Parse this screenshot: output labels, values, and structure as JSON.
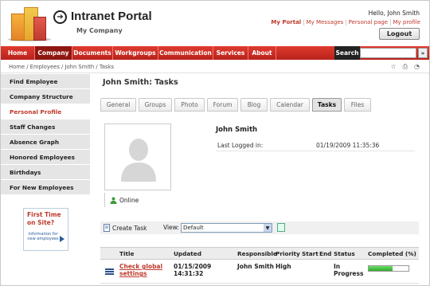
{
  "header": {
    "portal_title": "Intranet Portal",
    "company": "My Company",
    "greeting": "Hello, John Smith",
    "links": [
      "My Portal",
      "My Messages",
      "Personal page",
      "My profile"
    ],
    "logout_label": "Logout"
  },
  "nav": {
    "items": [
      "Home",
      "Company",
      "Documents",
      "Workgroups",
      "Communication",
      "Services",
      "About"
    ],
    "active": "Company",
    "search_label": "Search",
    "search_go": "»"
  },
  "breadcrumb": "Home / Employees / John Smith / Tasks",
  "left_menu": {
    "items": [
      "Find Employee",
      "Company Structure",
      "Personal Profile",
      "Staff Changes",
      "Absence Graph",
      "Honored Employees",
      "Birthdays",
      "For New Employees"
    ],
    "active": "Personal Profile"
  },
  "promo": {
    "title_line1": "First Time",
    "title_line2": "on Site?",
    "subtitle": "information for new employees"
  },
  "page": {
    "title": "John Smith: Tasks",
    "tabs": [
      "General",
      "Groups",
      "Photo",
      "Forum",
      "Blog",
      "Calendar",
      "Tasks",
      "Files"
    ],
    "active_tab": "Tasks"
  },
  "profile": {
    "name": "John Smith",
    "last_logged_label": "Last Logged in:",
    "last_logged_value": "01/19/2009 11:35:36",
    "status": "Online"
  },
  "tasks_toolbar": {
    "create_label": "Create Task",
    "view_label": "View:",
    "view_value": "Default"
  },
  "tasks_table": {
    "columns": [
      "Title",
      "Updated",
      "Responsible",
      "Priority",
      "Start",
      "End",
      "Status",
      "Completed (%)"
    ],
    "rows": [
      {
        "title_line1": "Check global",
        "title_line2": "settings",
        "updated_line1": "01/15/2009",
        "updated_line2": "14:31:32",
        "responsible": "John Smith",
        "priority": "High",
        "start": "",
        "end": "",
        "status_line1": "In",
        "status_line2": "Progress",
        "completed_pct": 60
      }
    ]
  },
  "colors": {
    "brand_red": "#c0392b",
    "nav_red": "#d2302a",
    "progress_green": "#2ea92a"
  }
}
